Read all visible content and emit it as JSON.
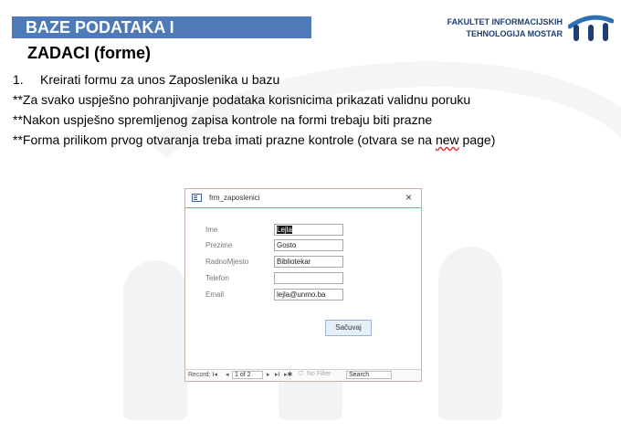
{
  "header": {
    "title": "BAZE PODATAKA I",
    "faculty_line1": "FAKULTET INFORMACIJSKIH",
    "faculty_line2": "TEHNOLOGIJA MOSTAR"
  },
  "subtitle": "ZADACI (forme)",
  "tasks": {
    "item1_num": "1.",
    "item1_text": "Kreirati formu za unos Zaposlenika u bazu",
    "note1": "**Za svako uspješno pohranjivanje podataka korisnicima prikazati validnu poruku",
    "note2": "**Nakon uspješno spremljenog zapisa kontrole na formi trebaju biti prazne",
    "note3_pre": "**Forma prilikom prvog otvaranja treba imati prazne kontrole (otvara se na ",
    "note3_new": "new",
    "note3_post": " page)"
  },
  "form": {
    "window_title": "frm_zaposlenici",
    "close_glyph": "×",
    "fields": [
      {
        "label": "Ime",
        "value": "Lejla"
      },
      {
        "label": "Prezime",
        "value": "Gosto"
      },
      {
        "label": "RadnoMjesto",
        "value": "Bibliotekar"
      },
      {
        "label": "Telefon",
        "value": ""
      },
      {
        "label": "Email",
        "value": "lejla@unmo.ba"
      }
    ],
    "save_label": "Sačuvaj",
    "nav": {
      "record_label": "Record: I◂",
      "prev": "◂",
      "position": "1 of 2",
      "next": "▸",
      "last": "▸I",
      "new_record": "▸✱",
      "filter": "No Filter",
      "search": "Search"
    }
  }
}
